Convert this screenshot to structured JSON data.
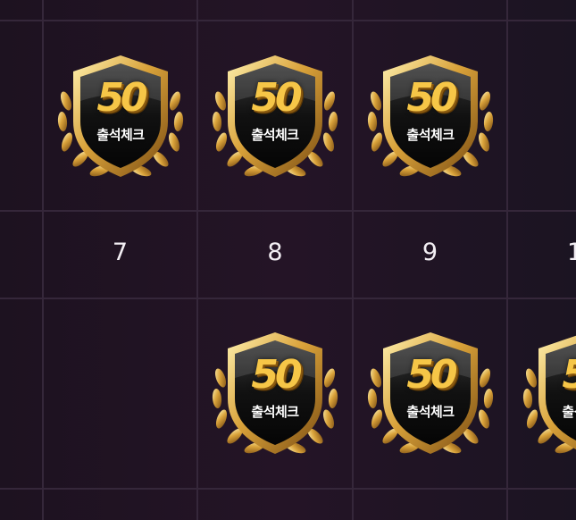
{
  "calendar": {
    "day_numbers": [
      "7",
      "8",
      "9",
      "1"
    ],
    "badge": {
      "number": "50",
      "label": "출석체크",
      "icon": "attendance-check-badge-icon"
    }
  },
  "colors": {
    "background": "#22131f",
    "gridline": "#35273a",
    "gold": "#f6c647",
    "text": "#f2eef3"
  }
}
